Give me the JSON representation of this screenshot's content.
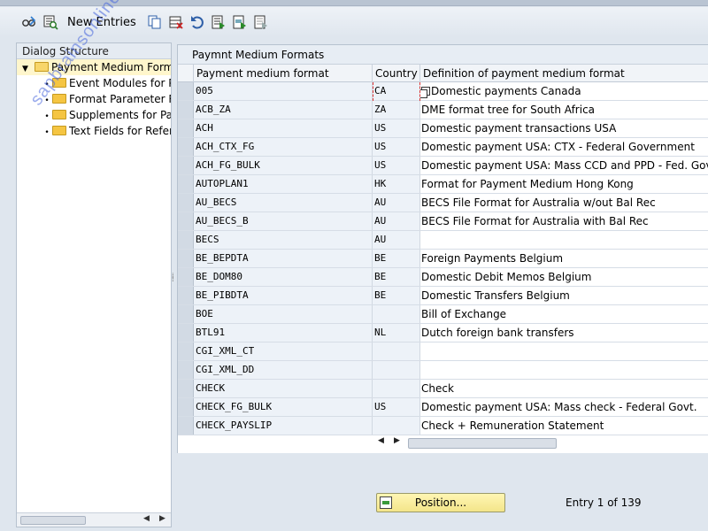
{
  "toolbar": {
    "new_entries_label": "New Entries",
    "icons": [
      "glasses-change-icon",
      "save-display-icon",
      "copy-icon",
      "delete-icon",
      "undo-icon",
      "select-all-icon",
      "select-block-icon",
      "deselect-all-icon"
    ]
  },
  "dialog_structure": {
    "header": "Dialog Structure",
    "root": "Payment Medium Formats",
    "children": [
      "Event Modules for Payment Medium Formats",
      "Format Parameter Records",
      "Supplements for Payment Medium Format",
      "Text Fields for Reference"
    ]
  },
  "table": {
    "title": "Paymnt Medium Formats",
    "columns": {
      "format": "Payment medium format",
      "country": "Country",
      "definition": "Definition of payment medium format"
    },
    "rows": [
      {
        "format": "005",
        "country": "CA",
        "definition": "Domestic payments Canada"
      },
      {
        "format": "ACB_ZA",
        "country": "ZA",
        "definition": "DME format tree for South Africa"
      },
      {
        "format": "ACH",
        "country": "US",
        "definition": "Domestic payment transactions USA"
      },
      {
        "format": "ACH_CTX_FG",
        "country": "US",
        "definition": "Domestic payment USA: CTX - Federal Government"
      },
      {
        "format": "ACH_FG_BULK",
        "country": "US",
        "definition": "Domestic payment USA: Mass CCD and PPD - Fed. Govt"
      },
      {
        "format": "AUTOPLAN1",
        "country": "HK",
        "definition": "Format for Payment Medium Hong Kong"
      },
      {
        "format": "AU_BECS",
        "country": "AU",
        "definition": "BECS File Format for Australia w/out Bal Rec"
      },
      {
        "format": "AU_BECS_B",
        "country": "AU",
        "definition": "BECS File Format for Australia with Bal Rec"
      },
      {
        "format": "BECS",
        "country": "AU",
        "definition": ""
      },
      {
        "format": "BE_BEPDTA",
        "country": "BE",
        "definition": "Foreign Payments Belgium"
      },
      {
        "format": "BE_DOM80",
        "country": "BE",
        "definition": "Domestic Debit Memos Belgium"
      },
      {
        "format": "BE_PIBDTA",
        "country": "BE",
        "definition": "Domestic Transfers Belgium"
      },
      {
        "format": "BOE",
        "country": "",
        "definition": "Bill of Exchange"
      },
      {
        "format": "BTL91",
        "country": "NL",
        "definition": "Dutch foreign bank transfers"
      },
      {
        "format": "CGI_XML_CT",
        "country": "",
        "definition": ""
      },
      {
        "format": "CGI_XML_DD",
        "country": "",
        "definition": ""
      },
      {
        "format": "CHECK",
        "country": "",
        "definition": "Check"
      },
      {
        "format": "CHECK_FG_BULK",
        "country": "US",
        "definition": "Domestic payment USA: Mass check - Federal Govt."
      },
      {
        "format": "CHECK_PAYSLIP",
        "country": "",
        "definition": "Check + Remuneration Statement"
      }
    ]
  },
  "footer": {
    "position_label": "Position...",
    "entry_info": "Entry 1 of 139"
  },
  "watermark": "sapbrainsonline.com"
}
